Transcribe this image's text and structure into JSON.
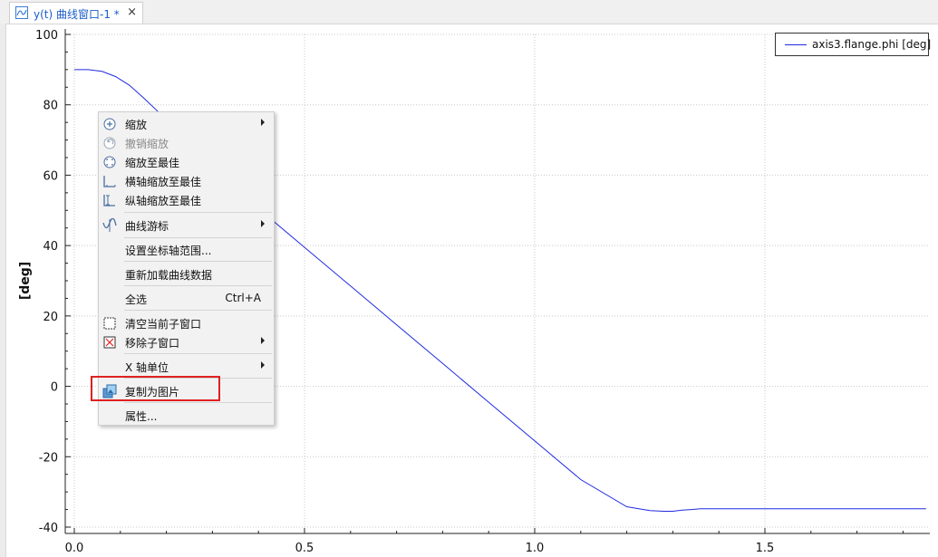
{
  "tab": {
    "title": "y(t) 曲线窗口-1 *",
    "close": "×",
    "icon": "curve-window-icon"
  },
  "chart_data": {
    "type": "line",
    "xlabel": "",
    "ylabel": "[deg]",
    "xlim": [
      0,
      1.85
    ],
    "ylim": [
      -40,
      100
    ],
    "x_ticks": [
      "0.0",
      "0.5",
      "1.0",
      "1.5"
    ],
    "y_ticks": [
      "100",
      "80",
      "60",
      "40",
      "20",
      "0",
      "-20",
      "-40"
    ],
    "grid": true,
    "legend_position": "top-right",
    "series": [
      {
        "name": "axis3.flange.phi [deg]",
        "color": "#1f2be0",
        "x": [
          0,
          0.03,
          0.06,
          0.09,
          0.12,
          0.15,
          0.18,
          0.21,
          0.24,
          0.27,
          0.3,
          0.4,
          0.5,
          0.6,
          0.7,
          0.8,
          0.9,
          1.0,
          1.1,
          1.2,
          1.25,
          1.28,
          1.3,
          1.32,
          1.34,
          1.36,
          1.4,
          1.5,
          1.6,
          1.7,
          1.85
        ],
        "y": [
          90,
          90,
          89.5,
          88,
          85.5,
          82,
          78.3,
          74.2,
          70,
          65.8,
          61.5,
          50.5,
          39.5,
          28.5,
          17.5,
          6.5,
          -4.5,
          -15.5,
          -26.5,
          -34.2,
          -35.3,
          -35.5,
          -35.5,
          -35.2,
          -35,
          -34.8,
          -34.8,
          -34.8,
          -34.8,
          -34.8,
          -34.8
        ]
      }
    ]
  },
  "context_menu": {
    "items": [
      {
        "label": "缩放",
        "icon": "zoom-in-icon",
        "submenu": true,
        "enabled": true
      },
      {
        "label": "撤销缩放",
        "icon": "undo-zoom-icon",
        "submenu": false,
        "enabled": false
      },
      {
        "label": "缩放至最佳",
        "icon": "zoom-fit-icon",
        "submenu": false,
        "enabled": true
      },
      {
        "label": "横轴缩放至最佳",
        "icon": "zoom-fit-horizontal-icon",
        "submenu": false,
        "enabled": true
      },
      {
        "label": "纵轴缩放至最佳",
        "icon": "zoom-fit-vertical-icon",
        "submenu": false,
        "enabled": true
      },
      {
        "label": "曲线游标",
        "icon": "cursor-curve-icon",
        "submenu": true,
        "enabled": true
      },
      {
        "label": "设置坐标轴范围...",
        "icon": "",
        "submenu": false,
        "enabled": true
      },
      {
        "label": "重新加载曲线数据",
        "icon": "",
        "submenu": false,
        "enabled": true
      },
      {
        "label": "全选",
        "shortcut": "Ctrl+A",
        "icon": "",
        "submenu": false,
        "enabled": true
      },
      {
        "label": "清空当前子窗口",
        "icon": "clear-window-icon",
        "submenu": false,
        "enabled": true
      },
      {
        "label": "移除子窗口",
        "icon": "remove-window-icon",
        "submenu": true,
        "enabled": true
      },
      {
        "label": "X 轴单位",
        "icon": "",
        "submenu": true,
        "enabled": true
      },
      {
        "label": "复制为图片",
        "icon": "copy-image-icon",
        "submenu": false,
        "enabled": true,
        "highlighted": true
      },
      {
        "label": "属性...",
        "icon": "",
        "submenu": false,
        "enabled": true
      }
    ]
  },
  "colors": {
    "curve": "#1f2be0",
    "highlight": "#e02020",
    "tab_text": "#1a5ec8"
  }
}
